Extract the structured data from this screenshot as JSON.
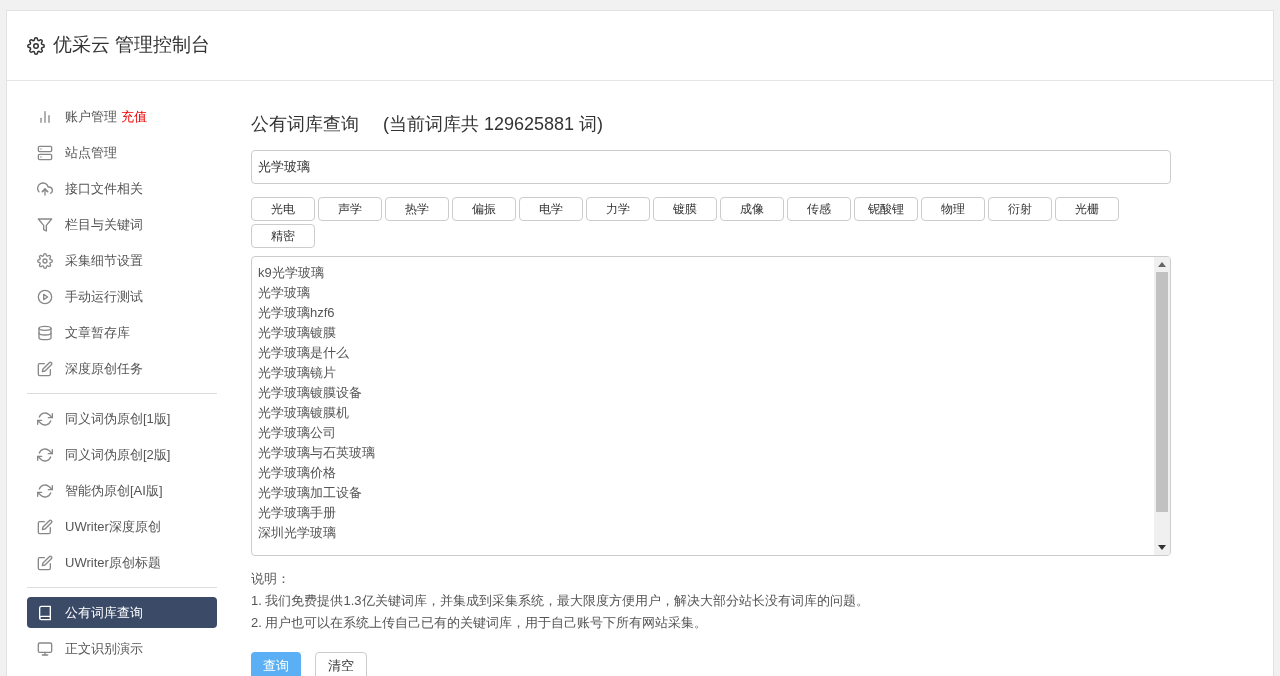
{
  "header": {
    "title": "优采云 管理控制台"
  },
  "sidebar": {
    "groups": [
      {
        "items": [
          {
            "label": "账户管理",
            "badge": "充值",
            "selected": false
          },
          {
            "label": "站点管理",
            "selected": false
          },
          {
            "label": "接口文件相关",
            "selected": false
          },
          {
            "label": "栏目与关键词",
            "selected": false
          },
          {
            "label": "采集细节设置",
            "selected": false
          },
          {
            "label": "手动运行测试",
            "selected": false
          },
          {
            "label": "文章暂存库",
            "selected": false
          },
          {
            "label": "深度原创任务",
            "selected": false
          }
        ]
      },
      {
        "items": [
          {
            "label": "同义词伪原创[1版]",
            "selected": false
          },
          {
            "label": "同义词伪原创[2版]",
            "selected": false
          },
          {
            "label": "智能伪原创[AI版]",
            "selected": false
          },
          {
            "label": "UWriter深度原创",
            "selected": false
          },
          {
            "label": "UWriter原创标题",
            "selected": false
          }
        ]
      },
      {
        "items": [
          {
            "label": "公有词库查询",
            "selected": true
          },
          {
            "label": "正文识别演示",
            "selected": false
          }
        ]
      }
    ]
  },
  "main": {
    "title": "公有词库查询",
    "subtitle": "(当前词库共 129625881 词)",
    "search": {
      "value": "光学玻璃"
    },
    "tags": [
      "光电",
      "声学",
      "热学",
      "偏振",
      "电学",
      "力学",
      "镀膜",
      "成像",
      "传感",
      "铌酸锂",
      "物理",
      "衍射",
      "光栅",
      "精密"
    ],
    "results": [
      "k9光学玻璃",
      "光学玻璃",
      "光学玻璃hzf6",
      "光学玻璃镀膜",
      "光学玻璃是什么",
      "光学玻璃镜片",
      "光学玻璃镀膜设备",
      "光学玻璃镀膜机",
      "光学玻璃公司",
      "光学玻璃与石英玻璃",
      "光学玻璃价格",
      "光学玻璃加工设备",
      "光学玻璃手册",
      "深圳光学玻璃"
    ],
    "notes_title": "说明：",
    "notes": [
      "1. 我们免费提供1.3亿关键词库，并集成到采集系统，最大限度方便用户，解决大部分站长没有词库的问题。",
      "2. 用户也可以在系统上传自己已有的关键词库，用于自己账号下所有网站采集。"
    ],
    "buttons": [
      {
        "label": "查询",
        "kind": "primary"
      },
      {
        "label": "清空",
        "kind": "default"
      }
    ]
  }
}
